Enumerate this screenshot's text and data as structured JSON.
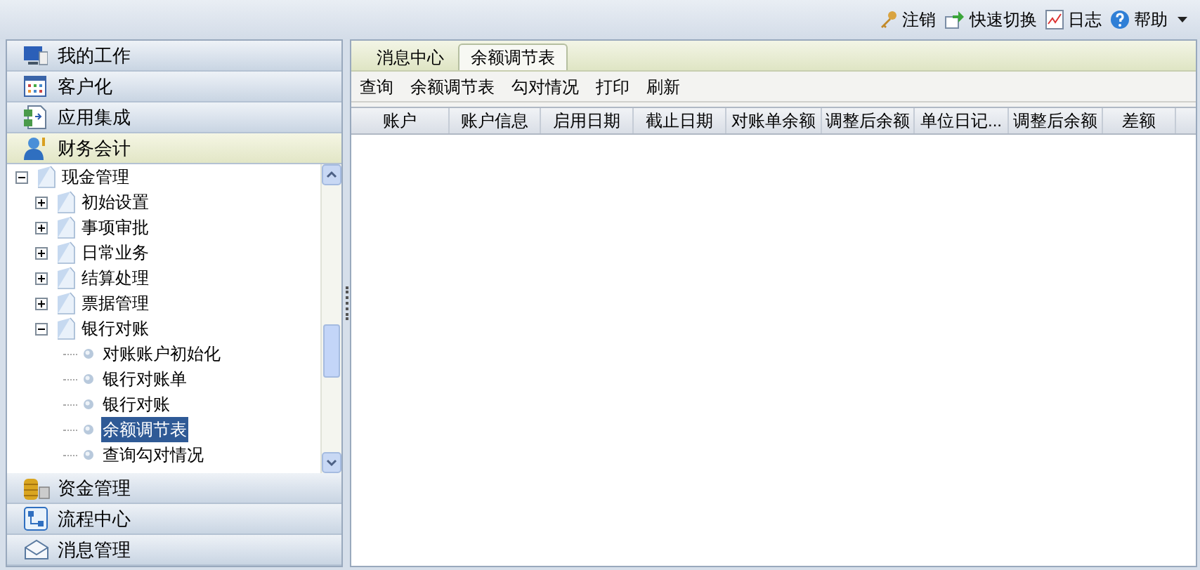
{
  "top_bar": {
    "links": [
      {
        "kind": "key",
        "label": "注销"
      },
      {
        "kind": "switch",
        "label": "快速切换"
      },
      {
        "kind": "log",
        "label": "日志"
      },
      {
        "kind": "help",
        "label": "帮助"
      }
    ]
  },
  "sidebar": {
    "sections_top": [
      {
        "kind": "monitor",
        "label": "我的工作",
        "selected": false
      },
      {
        "kind": "grid",
        "label": "客户化",
        "selected": false
      },
      {
        "kind": "doc",
        "label": "应用集成",
        "selected": false
      },
      {
        "kind": "person",
        "label": "财务会计",
        "selected": true
      }
    ],
    "tree": [
      {
        "label": "现金管理",
        "expanded": true,
        "children": [
          {
            "label": "初始设置",
            "expanded": false
          },
          {
            "label": "事项审批",
            "expanded": false
          },
          {
            "label": "日常业务",
            "expanded": false
          },
          {
            "label": "结算处理",
            "expanded": false
          },
          {
            "label": "票据管理",
            "expanded": false
          },
          {
            "label": "银行对账",
            "expanded": true,
            "children": [
              {
                "label": "对账账户初始化",
                "selected": false
              },
              {
                "label": "银行对账单",
                "selected": false
              },
              {
                "label": "银行对账",
                "selected": false
              },
              {
                "label": "余额调节表",
                "selected": true
              },
              {
                "label": "查询勾对情况",
                "selected": false
              }
            ]
          }
        ]
      }
    ],
    "sections_bottom": [
      {
        "kind": "coins",
        "label": "资金管理",
        "selected": false
      },
      {
        "kind": "flow",
        "label": "流程中心",
        "selected": false
      },
      {
        "kind": "mail",
        "label": "消息管理",
        "selected": false
      }
    ]
  },
  "tabs": [
    {
      "label": "消息中心",
      "selected": false
    },
    {
      "label": "余额调节表",
      "selected": true
    }
  ],
  "toolbar": [
    "查询",
    "余额调节表",
    "勾对情况",
    "打印",
    "刷新"
  ],
  "table": {
    "columns": [
      "账户",
      "账户信息",
      "启用日期",
      "截止日期",
      "对账单余额",
      "调整后余额",
      "单位日记...",
      "调整后余额",
      "差额"
    ]
  }
}
